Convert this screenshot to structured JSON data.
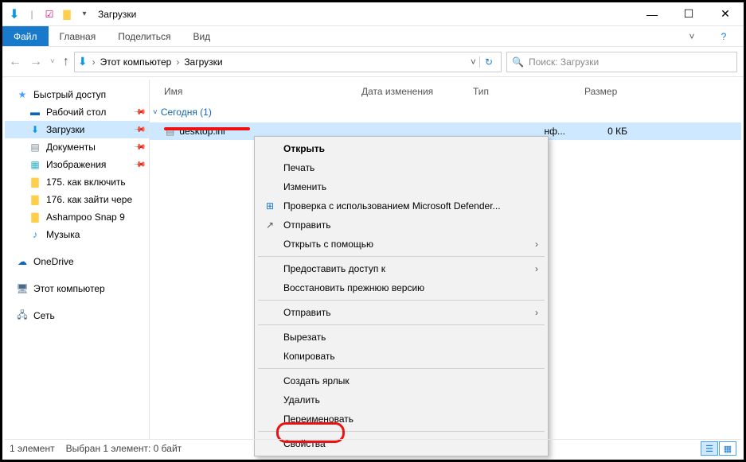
{
  "window": {
    "title": "Загрузки"
  },
  "ribbon": {
    "file": "Файл",
    "tabs": [
      "Главная",
      "Поделиться",
      "Вид"
    ]
  },
  "address": {
    "root": "Этот компьютер",
    "current": "Загрузки"
  },
  "search": {
    "placeholder": "Поиск: Загрузки"
  },
  "sidebar": {
    "quick_access": "Быстрый доступ",
    "items": [
      {
        "label": "Рабочий стол",
        "icon": "desktop",
        "pinned": true
      },
      {
        "label": "Загрузки",
        "icon": "downloads",
        "pinned": true,
        "selected": true
      },
      {
        "label": "Документы",
        "icon": "documents",
        "pinned": true
      },
      {
        "label": "Изображения",
        "icon": "pictures",
        "pinned": true
      },
      {
        "label": "175. как включить",
        "icon": "folder",
        "pinned": false
      },
      {
        "label": "176. как зайти чере",
        "icon": "folder",
        "pinned": false
      },
      {
        "label": "Ashampoo Snap 9",
        "icon": "folder",
        "pinned": false
      },
      {
        "label": "Музыка",
        "icon": "music",
        "pinned": false
      }
    ],
    "onedrive": "OneDrive",
    "this_pc": "Этот компьютер",
    "network": "Сеть"
  },
  "columns": {
    "name": "Имя",
    "date": "Дата изменения",
    "type": "Тип",
    "size": "Размер"
  },
  "group": {
    "header": "Сегодня (1)"
  },
  "file": {
    "name": "desktop.ini",
    "type_truncated": "нф...",
    "size": "0 КБ"
  },
  "context_menu": {
    "open": "Открыть",
    "print": "Печать",
    "edit": "Изменить",
    "defender": "Проверка с использованием Microsoft Defender...",
    "share": "Отправить",
    "open_with": "Открыть с помощью",
    "give_access": "Предоставить доступ к",
    "restore_prev": "Восстановить прежнюю версию",
    "send_to": "Отправить",
    "cut": "Вырезать",
    "copy": "Копировать",
    "shortcut": "Создать ярлык",
    "delete": "Удалить",
    "rename": "Переименовать",
    "properties": "Свойства"
  },
  "status": {
    "count": "1 элемент",
    "selection": "Выбран 1 элемент: 0 байт"
  }
}
